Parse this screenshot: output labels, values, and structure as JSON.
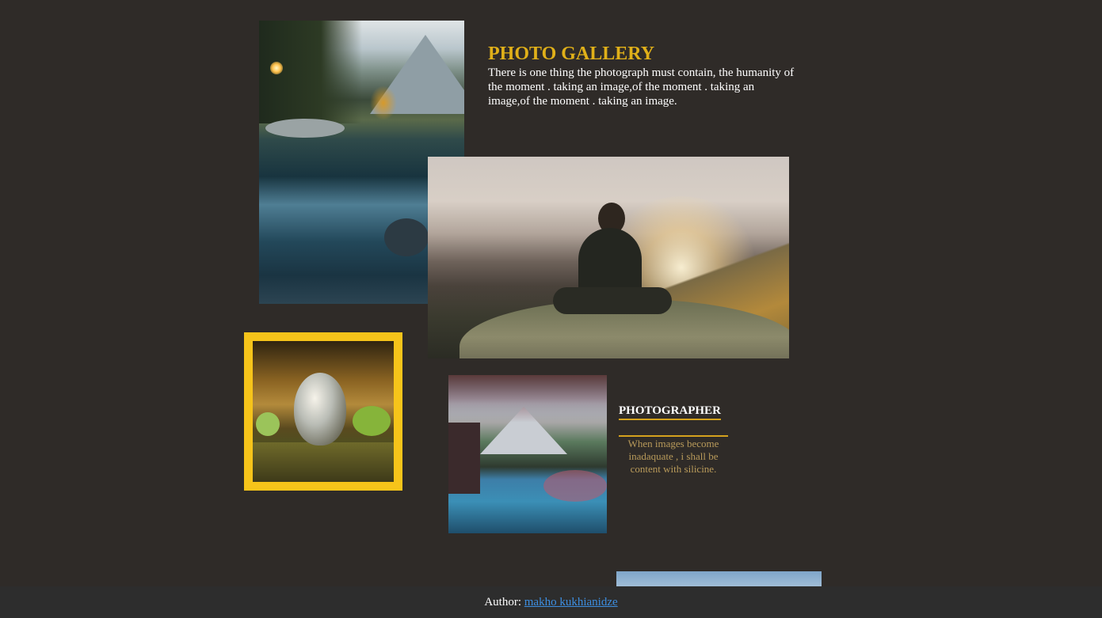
{
  "gallery": {
    "title": "PHOTO GALLERY",
    "intro": "There is one thing the photograph must contain, the humanity of the moment . taking an image,of the moment . taking an image,of the moment . taking an image."
  },
  "photographer": {
    "heading": "PHOTOGRAPHER",
    "quote": "When images become inadaquate , i shall be content with silicine."
  },
  "footer": {
    "label": "Author: ",
    "author_name": "makho kukhianidze"
  },
  "colors": {
    "background": "#2f2b28",
    "accent": "#e0b019",
    "frame": "#f6c41a",
    "link": "#3d8ee0",
    "footer_bg": "#2d2d2d"
  }
}
